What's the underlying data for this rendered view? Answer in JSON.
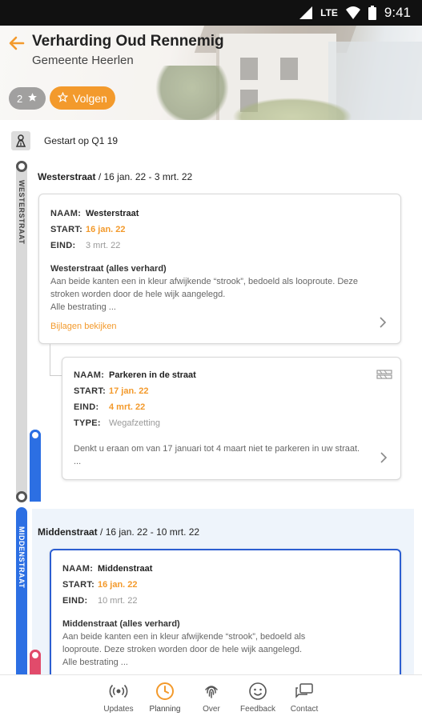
{
  "statusbar": {
    "network": "LTE",
    "time": "9:41"
  },
  "header": {
    "title": "Verharding Oud Rennemig",
    "subtitle": "Gemeente Heerlen",
    "rating": "2",
    "follow_label": "Volgen"
  },
  "timeline": {
    "started": "Gestart op Q1 19",
    "sections": [
      {
        "rail_label": "WESTERSTRAAT",
        "heading_name": "Westerstraat",
        "heading_dates": " / 16 jan. 22 - 3 mrt. 22",
        "card": {
          "naam_key": "NAAM:",
          "naam": "Westerstraat",
          "start_key": "START:",
          "start": "16 jan. 22",
          "eind_key": "EIND:",
          "eind": "3 mrt. 22",
          "desc_title": "Westerstraat (alles verhard)",
          "desc_lines": [
            "Aan beide kanten een in kleur afwijkende “strook”, bedoeld als looproute. Deze",
            "stroken worden door de hele wijk aangelegd.",
            "Alle bestrating ..."
          ],
          "link": "Bijlagen bekijken"
        },
        "subcard": {
          "naam_key": "NAAM:",
          "naam": "Parkeren in de straat",
          "start_key": "START:",
          "start": "17 jan. 22",
          "eind_key": "EIND:",
          "eind": "4 mrt. 22",
          "type_key": "TYPE:",
          "type": "Wegafzetting",
          "desc_lines": [
            "Denkt u eraan om van 17 januari tot 4 maart niet te parkeren in uw straat.",
            "..."
          ]
        }
      },
      {
        "rail_label": "MIDDENSTRAAT",
        "heading_name": "Middenstraat",
        "heading_dates": " / 16 jan. 22 - 10 mrt. 22",
        "card": {
          "naam_key": "NAAM:",
          "naam": "Middenstraat",
          "start_key": "START:",
          "start": "16 jan. 22",
          "eind_key": "EIND:",
          "eind": "10 mrt. 22",
          "desc_title": "Middenstraat (alles verhard)",
          "desc_lines": [
            "Aan beide kanten een in kleur afwijkende “strook”, bedoeld als",
            "looproute. Deze stroken worden door de hele wijk aangelegd.",
            "Alle bestrating ..."
          ]
        }
      }
    ]
  },
  "bottomnav": {
    "items": [
      {
        "label": "Updates",
        "icon": "broadcast-icon"
      },
      {
        "label": "Planning",
        "icon": "clock-icon"
      },
      {
        "label": "Over",
        "icon": "fingerprint-icon"
      },
      {
        "label": "Feedback",
        "icon": "smiley-icon"
      },
      {
        "label": "Contact",
        "icon": "chat-icon"
      }
    ]
  },
  "colors": {
    "accent": "#f39a2c",
    "rail_blue": "#2c6fe3",
    "rail_grey": "#d9d9d9"
  }
}
